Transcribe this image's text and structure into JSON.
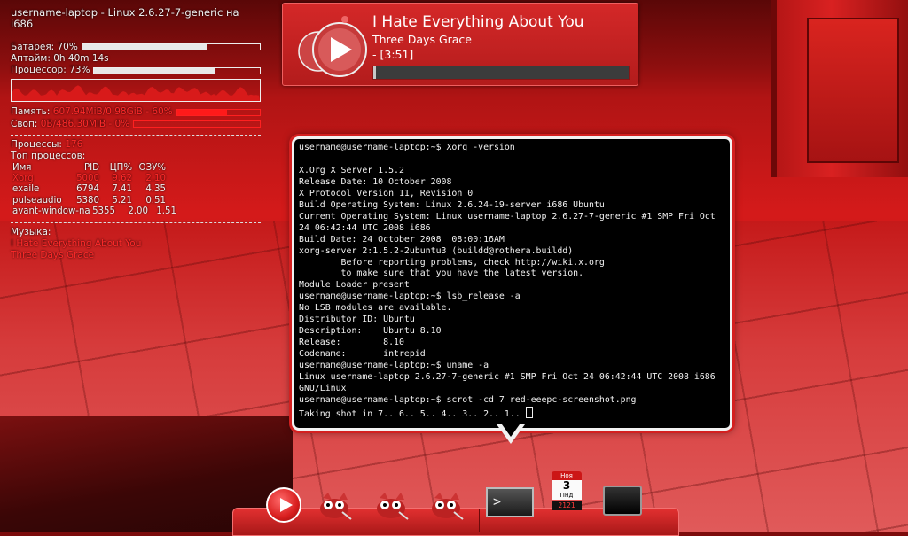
{
  "conky": {
    "header": "username-laptop - Linux 2.6.27-7-generic на i686",
    "battery_label": "Батарея: 70%",
    "battery_level": 0.7,
    "uptime_label": "Аптайм: 0h 40m 14s",
    "cpu_label": "Процессор: 73%",
    "cpu_level": 0.73,
    "mem_label": "Память:",
    "mem_value": "607.94MiB/0.98GiB - 60%",
    "mem_level": 0.6,
    "swap_label": "Своп:",
    "swap_value": "0B/486.30MiB - 0%",
    "swap_level": 0.0,
    "processes_label": "Процессы:",
    "processes_value": "176",
    "top_label": "Топ процессов:",
    "table_headers": [
      "Имя",
      "PID",
      "ЦП%",
      "ОЗУ%"
    ],
    "table_rows": [
      [
        "Xorg",
        "5000",
        "9.62",
        "2.10"
      ],
      [
        "exaile",
        "6794",
        "7.41",
        "4.35"
      ],
      [
        "pulseaudio",
        "5380",
        "5.21",
        "0.51"
      ],
      [
        "avant-window-na",
        "5355",
        "2.00",
        "1.51"
      ]
    ],
    "music_label": "Музыка:",
    "music_title": "I Hate Everything About You",
    "music_artist": "Three Days Grace"
  },
  "player": {
    "title": "I Hate Everything About You",
    "artist": "Three Days Grace",
    "time": " - [3:51]",
    "progress": 0.01
  },
  "terminal": {
    "lines": [
      "username@username-laptop:~$ Xorg -version",
      "",
      "X.Org X Server 1.5.2",
      "Release Date: 10 October 2008",
      "X Protocol Version 11, Revision 0",
      "Build Operating System: Linux 2.6.24-19-server i686 Ubuntu",
      "Current Operating System: Linux username-laptop 2.6.27-7-generic #1 SMP Fri Oct",
      "24 06:42:44 UTC 2008 i686",
      "Build Date: 24 October 2008  08:00:16AM",
      "xorg-server 2:1.5.2-2ubuntu3 (buildd@rothera.buildd)",
      "        Before reporting problems, check http://wiki.x.org",
      "        to make sure that you have the latest version.",
      "Module Loader present",
      "username@username-laptop:~$ lsb_release -a",
      "No LSB modules are available.",
      "Distributor ID: Ubuntu",
      "Description:    Ubuntu 8.10",
      "Release:        8.10",
      "Codename:       intrepid",
      "username@username-laptop:~$ uname -a",
      "Linux username-laptop 2.6.27-7-generic #1 SMP Fri Oct 24 06:42:44 UTC 2008 i686",
      "GNU/Linux",
      "username@username-laptop:~$ scrot -cd 7 red-eeepc-screenshot.png",
      "Taking shot in 7.. 6.. 5.. 4.. 3.. 2.. 1.. "
    ]
  },
  "dock": {
    "calendar_month": "Ноя",
    "calendar_day": "3",
    "calendar_weekday": "Пнд",
    "clock": "2121",
    "icons": [
      "music-player-icon",
      "gimp-icon",
      "gimp-icon",
      "gimp-icon",
      "terminal-icon",
      "calendar-icon",
      "monitor-icon"
    ]
  },
  "colors": {
    "accent": "#ff2a2a",
    "terminal_bg": "#000000"
  }
}
